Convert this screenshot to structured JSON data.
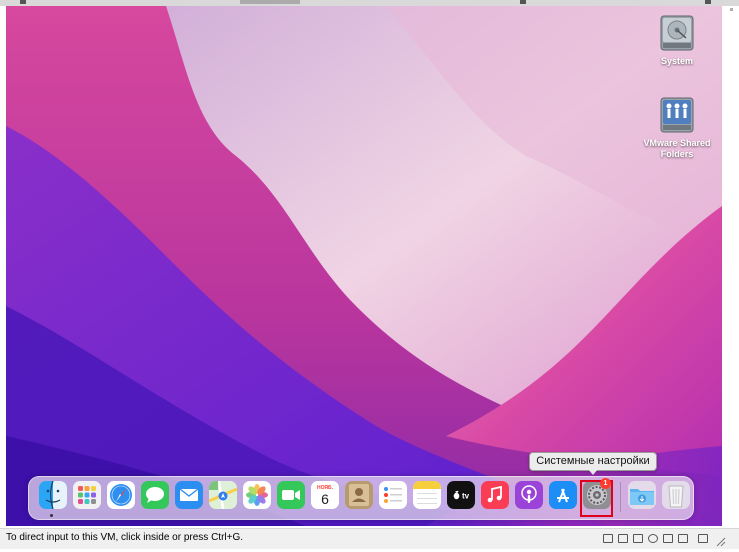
{
  "desktop": {
    "icons": [
      {
        "label": "System",
        "icon": "hard-drive-icon"
      },
      {
        "label": "VMware Shared Folders",
        "label_line1": "VMware Shared",
        "label_line2": "Folders",
        "icon": "shared-folders-icon"
      }
    ]
  },
  "dock": {
    "apps": [
      {
        "name": "Finder",
        "icon": "finder-icon",
        "running": true
      },
      {
        "name": "Launchpad",
        "icon": "launchpad-icon"
      },
      {
        "name": "Safari",
        "icon": "safari-icon"
      },
      {
        "name": "Messages",
        "icon": "messages-icon"
      },
      {
        "name": "Mail",
        "icon": "mail-icon"
      },
      {
        "name": "Maps",
        "icon": "maps-icon"
      },
      {
        "name": "Photos",
        "icon": "photos-icon"
      },
      {
        "name": "FaceTime",
        "icon": "facetime-icon"
      },
      {
        "name": "Calendar",
        "icon": "calendar-icon",
        "month": "НОЯБ.",
        "day": "6"
      },
      {
        "name": "Contacts",
        "icon": "contacts-icon"
      },
      {
        "name": "Reminders",
        "icon": "reminders-icon"
      },
      {
        "name": "Notes",
        "icon": "notes-icon"
      },
      {
        "name": "TV",
        "icon": "apple-tv-icon",
        "text": "tv"
      },
      {
        "name": "Music",
        "icon": "music-icon"
      },
      {
        "name": "Podcasts",
        "icon": "podcasts-icon"
      },
      {
        "name": "App Store",
        "icon": "app-store-icon"
      },
      {
        "name": "System Settings",
        "icon": "system-settings-icon",
        "badge": "1",
        "highlighted": true
      },
      {
        "name": "Downloads",
        "icon": "downloads-folder-icon"
      },
      {
        "name": "Trash",
        "icon": "trash-icon"
      }
    ],
    "tooltip": "Системные настройки"
  },
  "statusbar": {
    "message": "To direct input to this VM, click inside or press Ctrl+G."
  },
  "colors": {
    "highlight": "#e0001b",
    "badge": "#ff3b30"
  }
}
